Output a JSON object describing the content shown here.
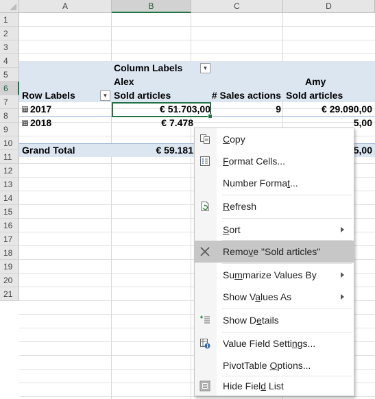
{
  "columns": [
    "A",
    "B",
    "C",
    "D"
  ],
  "rows": [
    "1",
    "2",
    "3",
    "4",
    "5",
    "6",
    "7",
    "8",
    "9",
    "10",
    "11",
    "12",
    "13",
    "14",
    "15",
    "16",
    "17",
    "18",
    "19",
    "20",
    "21"
  ],
  "pivot": {
    "column_labels": "Column Labels",
    "alex": "Alex",
    "amy": "Amy",
    "row_labels": "Row Labels",
    "sold_articles_b": "Sold articles",
    "sales_actions_c": "# Sales actions",
    "sold_articles_d": "Sold articles",
    "expand_glyph": "⊞",
    "row_2017": {
      "label": "2017",
      "b": "€ 51.703,00",
      "c": "9",
      "d": "€ 29.090,00"
    },
    "row_2018": {
      "label": "2018",
      "b": "€ 7.478",
      "d_tail": "5,00"
    },
    "grand_total": {
      "label": "Grand Total",
      "b": "€ 59.181",
      "d_tail": "5,00"
    }
  },
  "context_menu": {
    "items": [
      {
        "pre": "",
        "u": "C",
        "post": "opy",
        "icon": "copy-icon"
      },
      {
        "pre": "",
        "u": "F",
        "post": "ormat Cells...",
        "icon": "format-cells-icon"
      },
      {
        "pre": "Number Forma",
        "u": "t",
        "post": "...",
        "icon": ""
      },
      {
        "pre": "",
        "u": "R",
        "post": "efresh",
        "icon": "refresh-icon"
      },
      {
        "pre": "",
        "u": "S",
        "post": "ort",
        "icon": ""
      },
      {
        "pre": "Remo",
        "u": "v",
        "post": "e \"Sold articles\"",
        "icon": "remove-icon"
      },
      {
        "pre": "Su",
        "u": "m",
        "post": "marize Values By",
        "icon": ""
      },
      {
        "pre": "Show V",
        "u": "a",
        "post": "lues As",
        "icon": ""
      },
      {
        "pre": "Show D",
        "u": "e",
        "post": "tails",
        "icon": "show-details-icon"
      },
      {
        "pre": "Value Field Setti",
        "u": "n",
        "post": "gs...",
        "icon": "value-field-settings-icon"
      },
      {
        "pre": "PivotTable ",
        "u": "O",
        "post": "ptions...",
        "icon": ""
      },
      {
        "pre": "Hide Fiel",
        "u": "d",
        "post": " List",
        "icon": "hide-field-list-icon"
      }
    ]
  },
  "colors": {
    "accent": "#217346",
    "pivot_band": "#dce6f1",
    "menu_highlight": "#c7c7c7"
  }
}
